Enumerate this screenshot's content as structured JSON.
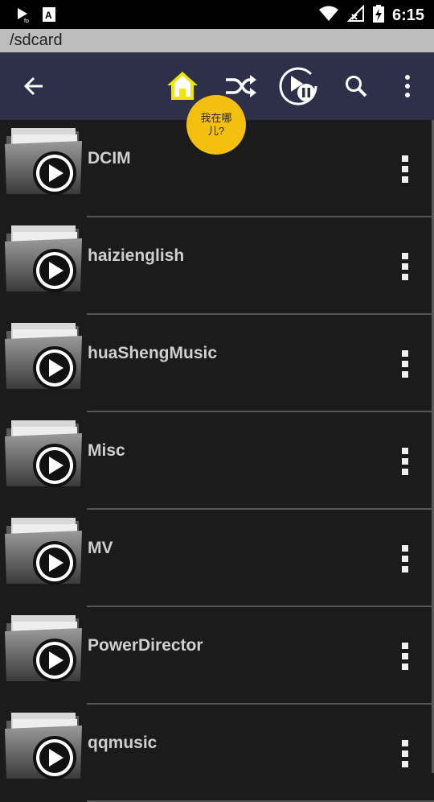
{
  "status_bar": {
    "time": "6:15",
    "icons": [
      "play-notification-icon",
      "a-notification-icon",
      "wifi-icon",
      "no-signal-icon",
      "battery-charging-icon"
    ]
  },
  "path_bar": {
    "path": "/sdcard"
  },
  "toolbar": {
    "buttons": [
      "back-arrow-icon",
      "home-icon",
      "shuffle-icon",
      "play-pause-icon",
      "search-icon",
      "more-vert-icon"
    ],
    "home_color": "#f2e600"
  },
  "tooltip": {
    "text": "我在哪儿?"
  },
  "folders": [
    {
      "name": "DCIM"
    },
    {
      "name": "haizienglish"
    },
    {
      "name": "huaShengMusic"
    },
    {
      "name": "Misc"
    },
    {
      "name": "MV"
    },
    {
      "name": "PowerDirector"
    },
    {
      "name": "qqmusic"
    }
  ],
  "colors": {
    "toolbar_bg": "#2e2f48",
    "path_bar_bg": "#bdbdbd",
    "tooltip_bg": "#f4c010",
    "list_bg": "#1b1b1b"
  }
}
